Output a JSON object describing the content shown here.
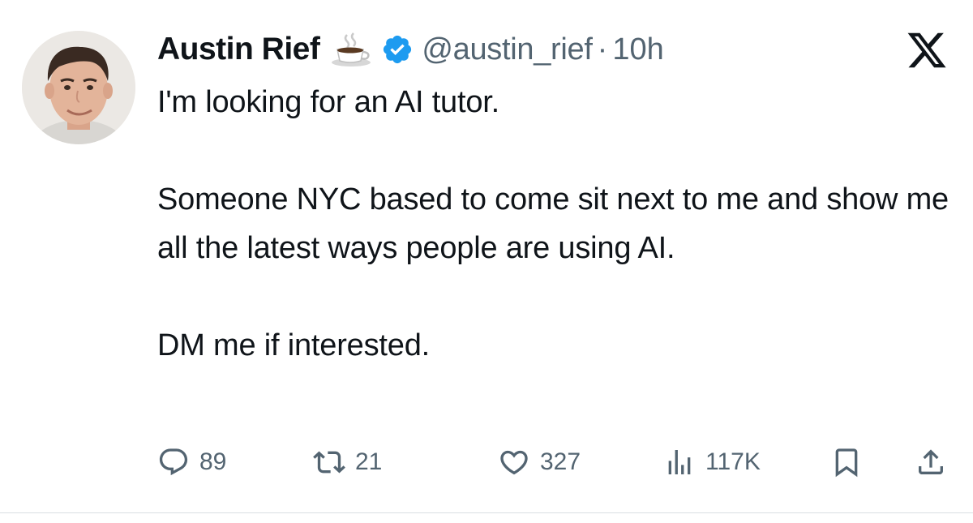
{
  "tweet": {
    "author_name": "Austin Rief",
    "handle": "@austin_rief",
    "separator": "·",
    "time": "10h",
    "paragraphs": [
      "I'm looking for an AI tutor.",
      "Someone NYC based to come sit next to me and show me all the latest ways people are using AI.",
      "DM me if interested."
    ],
    "icons": {
      "name_emoji": "coffee-icon",
      "badge": "verified-badge-icon",
      "platform": "x-logo-icon"
    },
    "colors": {
      "text": "#0f1419",
      "muted": "#536471",
      "verified": "#1d9bf0"
    }
  },
  "actions": {
    "replies": "89",
    "reposts": "21",
    "likes": "327",
    "views": "117K"
  }
}
